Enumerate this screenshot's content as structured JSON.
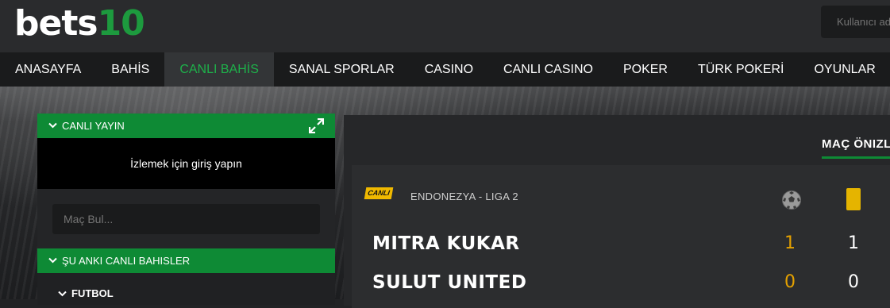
{
  "header": {
    "logo_main": "bets",
    "logo_accent": "10",
    "username_placeholder": "Kullanıcı adı"
  },
  "nav": [
    {
      "label": "ANASAYFA"
    },
    {
      "label": "BAHİS"
    },
    {
      "label": "CANLI BAHİS",
      "active": true
    },
    {
      "label": "SANAL SPORLAR"
    },
    {
      "label": "CASINO"
    },
    {
      "label": "CANLI CASINO"
    },
    {
      "label": "POKER"
    },
    {
      "label": "TÜRK POKERİ"
    },
    {
      "label": "OYUNLAR"
    }
  ],
  "live_stream": {
    "title": "CANLI YAYIN",
    "message": "İzlemek için giriş yapın"
  },
  "search": {
    "placeholder": "Maç Bul..."
  },
  "live_bets": {
    "title": "ŞU ANKI CANLI BAHISLER",
    "sport": "FUTBOL"
  },
  "match": {
    "tab": "MAÇ ÖNIZLEME",
    "badge": "CANLI",
    "league": "ENDONEZYA - LIGA 2",
    "home_team": "MITRA KUKAR",
    "away_team": "SULUT UNITED",
    "home_goals": "1",
    "away_goals": "0",
    "home_cards": "1",
    "away_cards": "0"
  },
  "colors": {
    "brand_green": "#0e8a35",
    "active_nav_text": "#1eb04a",
    "live_yellow": "#f0b900"
  }
}
